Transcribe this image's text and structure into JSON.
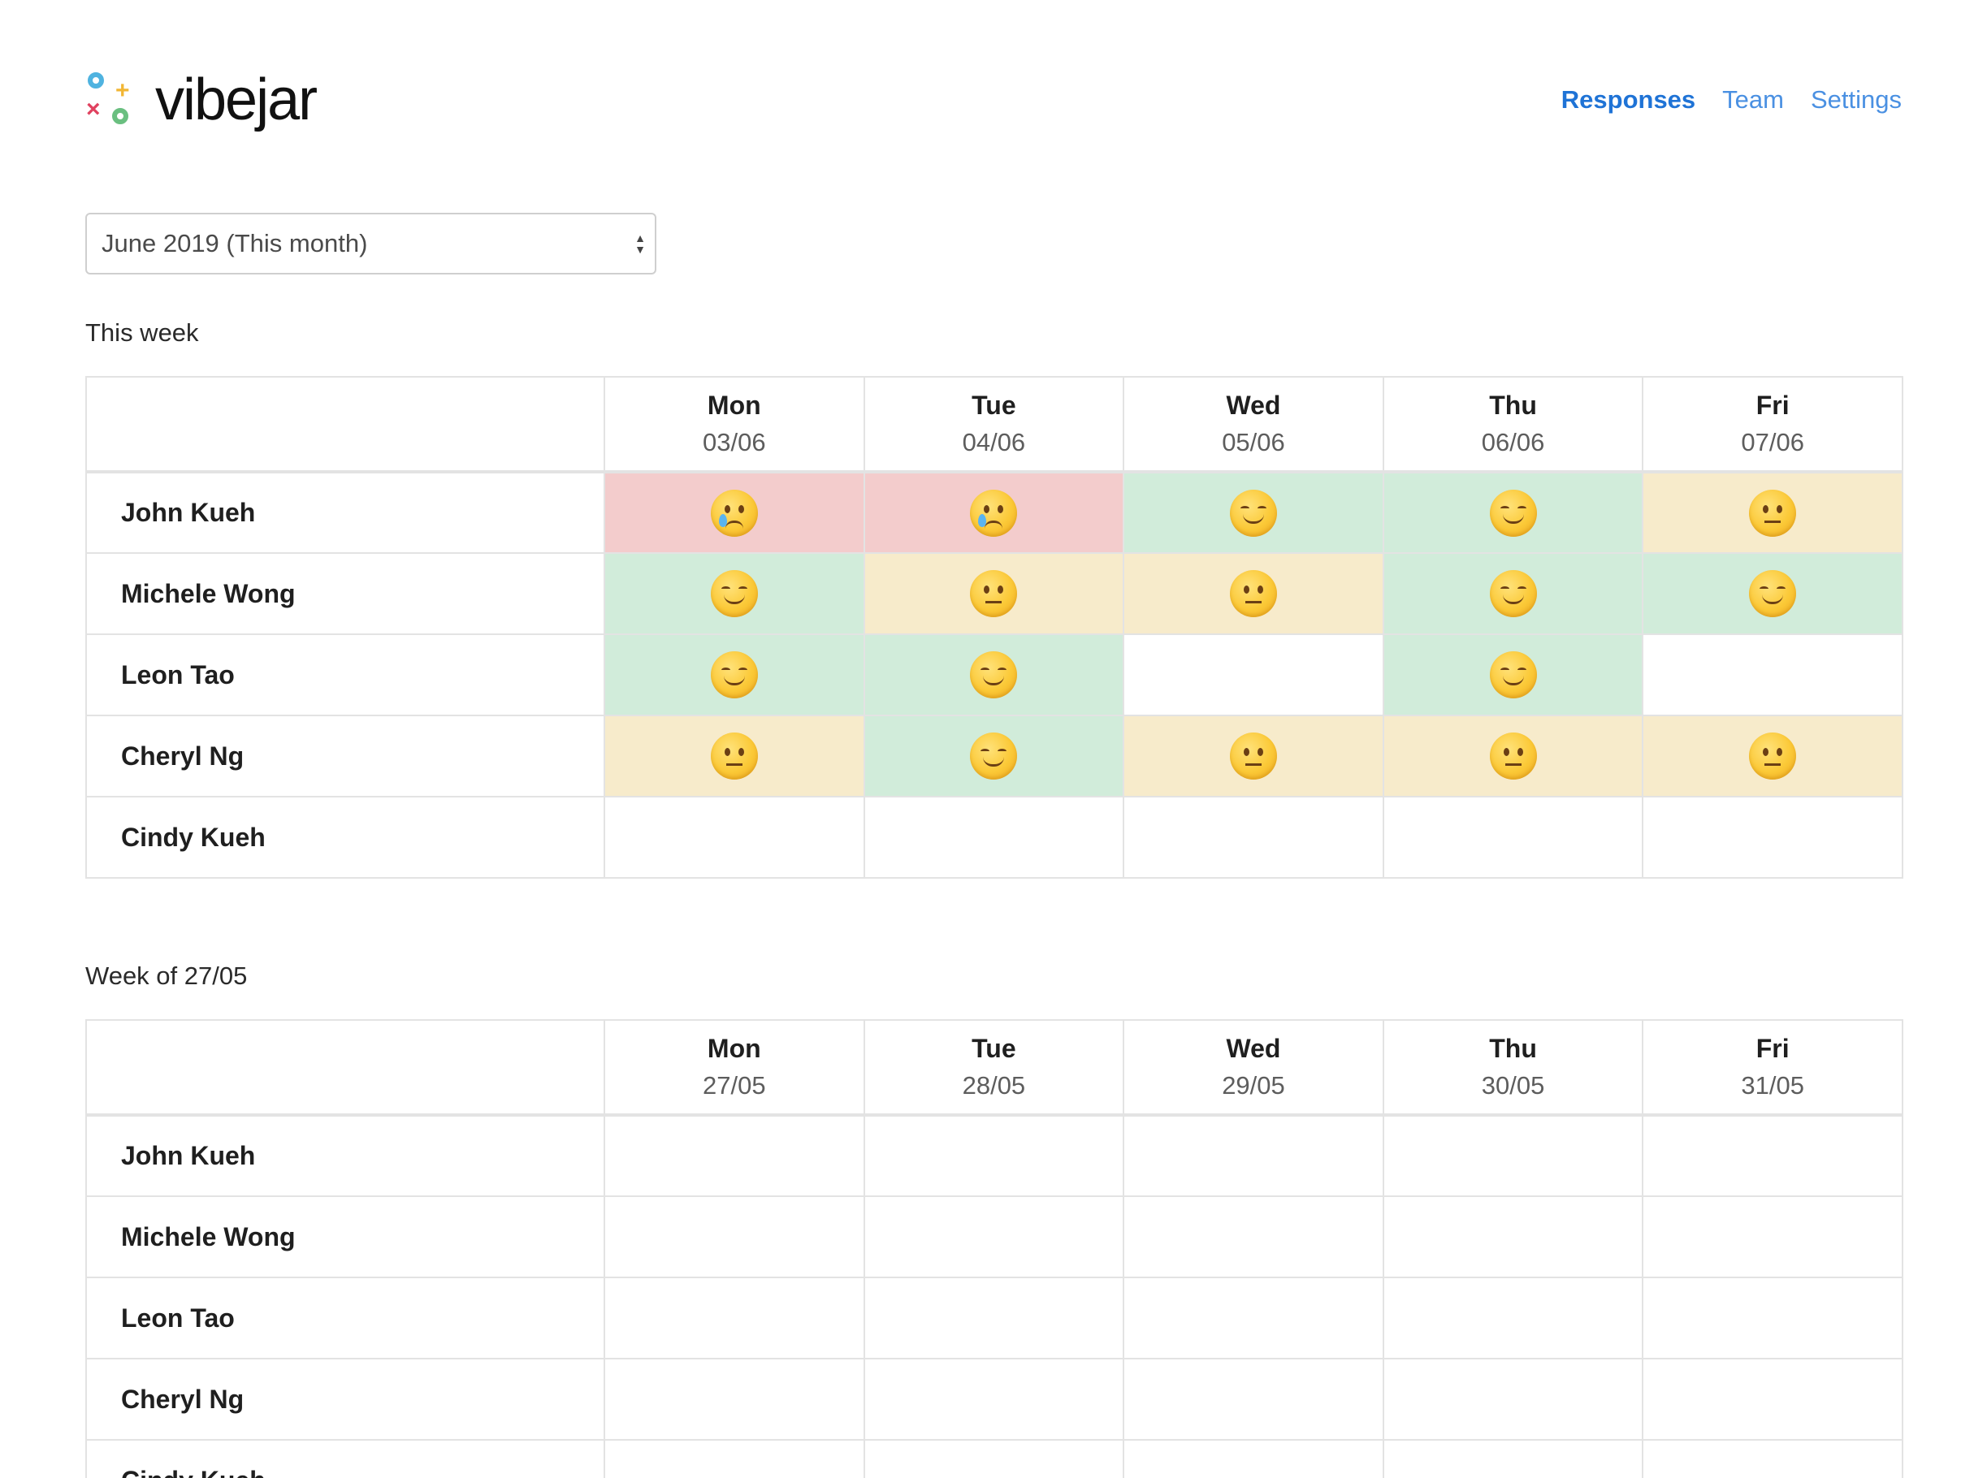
{
  "brand": {
    "name": "vibejar"
  },
  "nav": {
    "items": [
      {
        "label": "Responses",
        "active": true
      },
      {
        "label": "Team",
        "active": false
      },
      {
        "label": "Settings",
        "active": false
      }
    ]
  },
  "month_select": {
    "value": "June 2019 (This month)"
  },
  "colors": {
    "sad": "#f3cccc",
    "happy": "#d1ecda",
    "neutral": "#f7ebcb",
    "link": "#4a90e2",
    "link_active": "#1f73d6"
  },
  "weeks": [
    {
      "label": "This week",
      "days": [
        {
          "name": "Mon",
          "date": "03/06"
        },
        {
          "name": "Tue",
          "date": "04/06"
        },
        {
          "name": "Wed",
          "date": "05/06"
        },
        {
          "name": "Thu",
          "date": "06/06"
        },
        {
          "name": "Fri",
          "date": "07/06"
        }
      ],
      "rows": [
        {
          "name": "John Kueh",
          "moods": [
            "sad",
            "sad",
            "happy",
            "happy",
            "neutral"
          ]
        },
        {
          "name": "Michele Wong",
          "moods": [
            "happy",
            "neutral",
            "neutral",
            "happy",
            "happy"
          ]
        },
        {
          "name": "Leon Tao",
          "moods": [
            "happy",
            "happy",
            "none",
            "happy",
            "none"
          ]
        },
        {
          "name": "Cheryl Ng",
          "moods": [
            "neutral",
            "happy",
            "neutral",
            "neutral",
            "neutral"
          ]
        },
        {
          "name": "Cindy Kueh",
          "moods": [
            "none",
            "none",
            "none",
            "none",
            "none"
          ]
        }
      ]
    },
    {
      "label": "Week of 27/05",
      "days": [
        {
          "name": "Mon",
          "date": "27/05"
        },
        {
          "name": "Tue",
          "date": "28/05"
        },
        {
          "name": "Wed",
          "date": "29/05"
        },
        {
          "name": "Thu",
          "date": "30/05"
        },
        {
          "name": "Fri",
          "date": "31/05"
        }
      ],
      "rows": [
        {
          "name": "John Kueh",
          "moods": [
            "none",
            "none",
            "none",
            "none",
            "none"
          ]
        },
        {
          "name": "Michele Wong",
          "moods": [
            "none",
            "none",
            "none",
            "none",
            "none"
          ]
        },
        {
          "name": "Leon Tao",
          "moods": [
            "none",
            "none",
            "none",
            "none",
            "none"
          ]
        },
        {
          "name": "Cheryl Ng",
          "moods": [
            "none",
            "none",
            "none",
            "none",
            "none"
          ]
        },
        {
          "name": "Cindy Kueh",
          "moods": [
            "none",
            "none",
            "none",
            "none",
            "none"
          ]
        }
      ]
    }
  ]
}
